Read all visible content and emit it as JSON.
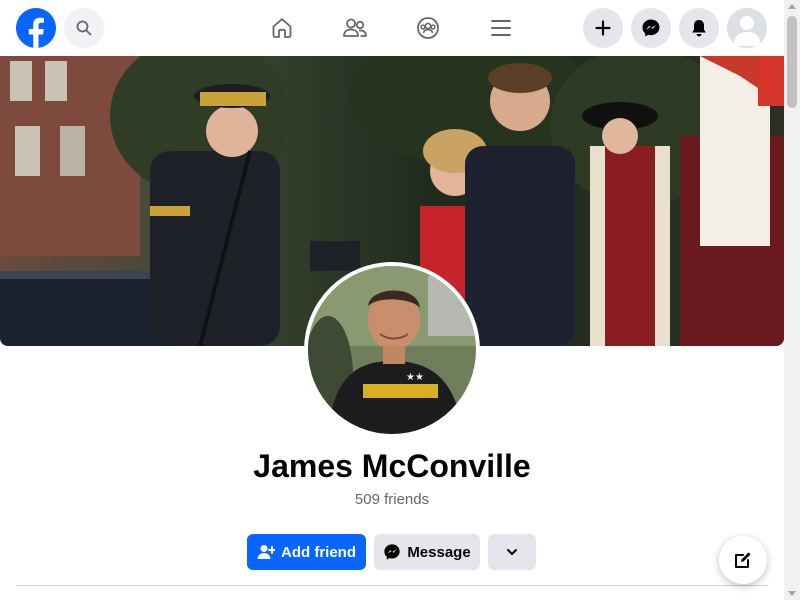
{
  "header": {
    "logo_icon": "facebook-logo",
    "search_icon": "search-icon",
    "nav": [
      "home-icon",
      "friends-icon",
      "groups-icon",
      "menu-icon"
    ],
    "actions": [
      "create-plus-icon",
      "messenger-icon",
      "notifications-bell-icon",
      "account-avatar"
    ]
  },
  "profile": {
    "name": "James McConville",
    "friends_count": "509 friends"
  },
  "actions": {
    "add_friend": "Add friend",
    "message": "Message"
  },
  "colors": {
    "brand": "#0866ff",
    "button_gray": "#e4e6eb",
    "text_secondary": "#65676b"
  }
}
